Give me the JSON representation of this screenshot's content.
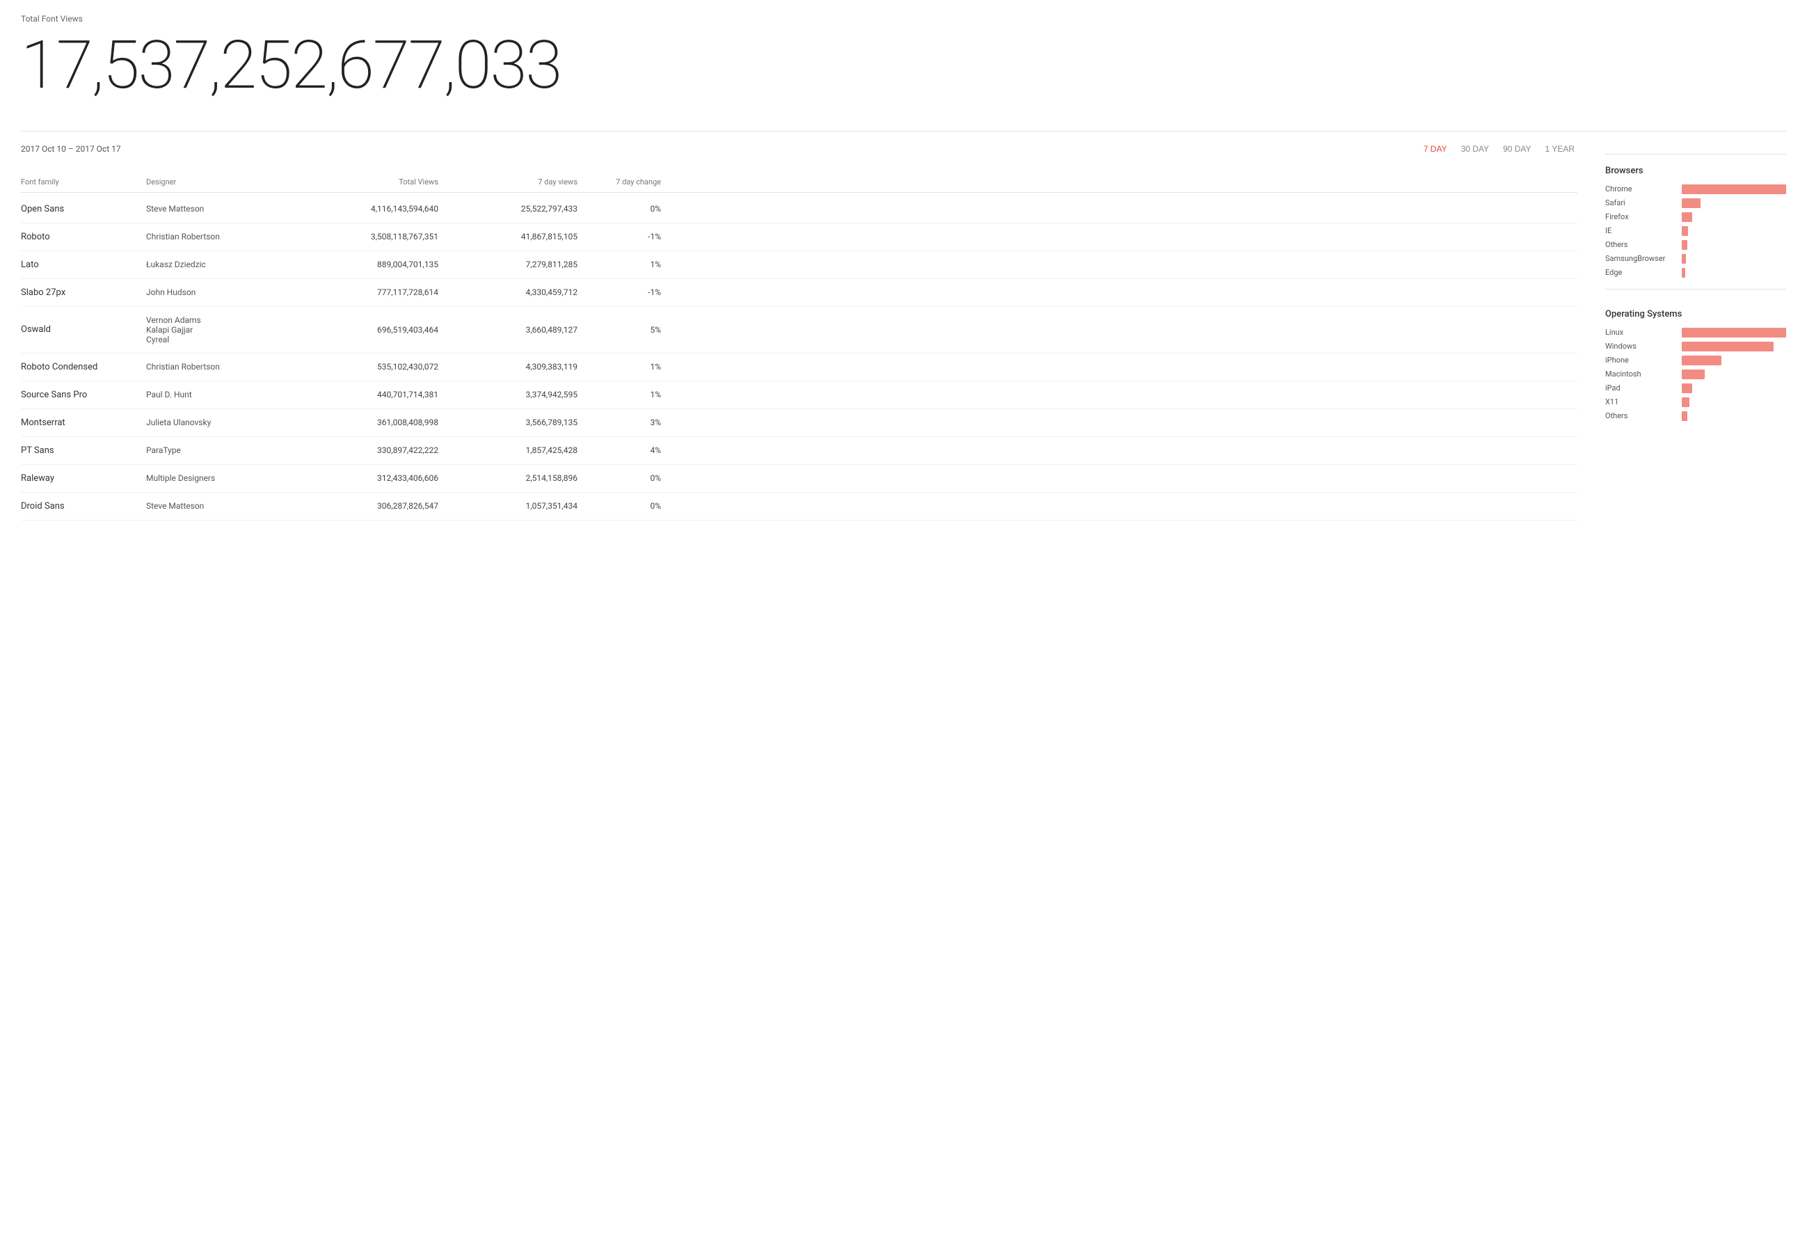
{
  "header": {
    "total_label": "Total Font Views",
    "total_number": "17,537,252,677,033"
  },
  "date_bar": {
    "date_range": "2017 Oct 10 – 2017 Oct 17",
    "periods": [
      "7 DAY",
      "30 DAY",
      "90 DAY",
      "1 YEAR"
    ],
    "active_period": "7 DAY"
  },
  "table": {
    "columns": [
      "Font family",
      "Designer",
      "Total Views",
      "7 day views",
      "7 day change"
    ],
    "rows": [
      {
        "font": "Open Sans",
        "designer": "Steve Matteson",
        "total": "4,116,143,594,640",
        "views7": "25,522,797,433",
        "change": "0%"
      },
      {
        "font": "Roboto",
        "designer": "Christian Robertson",
        "total": "3,508,118,767,351",
        "views7": "41,867,815,105",
        "change": "-1%"
      },
      {
        "font": "Lato",
        "designer": "Łukasz Dziedzic",
        "total": "889,004,701,135",
        "views7": "7,279,811,285",
        "change": "1%"
      },
      {
        "font": "Slabo 27px",
        "designer": "John Hudson",
        "total": "777,117,728,614",
        "views7": "4,330,459,712",
        "change": "-1%"
      },
      {
        "font": "Oswald",
        "designer": "Vernon Adams\nKalapi Gajjar\nCyreal",
        "total": "696,519,403,464",
        "views7": "3,660,489,127",
        "change": "5%"
      },
      {
        "font": "Roboto Condensed",
        "designer": "Christian Robertson",
        "total": "535,102,430,072",
        "views7": "4,309,383,119",
        "change": "1%"
      },
      {
        "font": "Source Sans Pro",
        "designer": "Paul D. Hunt",
        "total": "440,701,714,381",
        "views7": "3,374,942,595",
        "change": "1%"
      },
      {
        "font": "Montserrat",
        "designer": "Julieta Ulanovsky",
        "total": "361,008,408,998",
        "views7": "3,566,789,135",
        "change": "3%"
      },
      {
        "font": "PT Sans",
        "designer": "ParaType",
        "total": "330,897,422,222",
        "views7": "1,857,425,428",
        "change": "4%"
      },
      {
        "font": "Raleway",
        "designer": "Multiple Designers",
        "total": "312,433,406,606",
        "views7": "2,514,158,896",
        "change": "0%"
      },
      {
        "font": "Droid Sans",
        "designer": "Steve Matteson",
        "total": "306,287,826,547",
        "views7": "1,057,351,434",
        "change": "0%"
      }
    ]
  },
  "browsers": {
    "title": "Browsers",
    "items": [
      {
        "name": "Chrome",
        "pct": 100
      },
      {
        "name": "Safari",
        "pct": 18
      },
      {
        "name": "Firefox",
        "pct": 10
      },
      {
        "name": "IE",
        "pct": 6
      },
      {
        "name": "Others",
        "pct": 5
      },
      {
        "name": "SamsungBrowser",
        "pct": 4
      },
      {
        "name": "Edge",
        "pct": 3
      }
    ]
  },
  "os": {
    "title": "Operating Systems",
    "items": [
      {
        "name": "Linux",
        "pct": 100
      },
      {
        "name": "Windows",
        "pct": 88
      },
      {
        "name": "iPhone",
        "pct": 38
      },
      {
        "name": "Macintosh",
        "pct": 22
      },
      {
        "name": "iPad",
        "pct": 10
      },
      {
        "name": "X11",
        "pct": 7
      },
      {
        "name": "Others",
        "pct": 5
      }
    ]
  }
}
